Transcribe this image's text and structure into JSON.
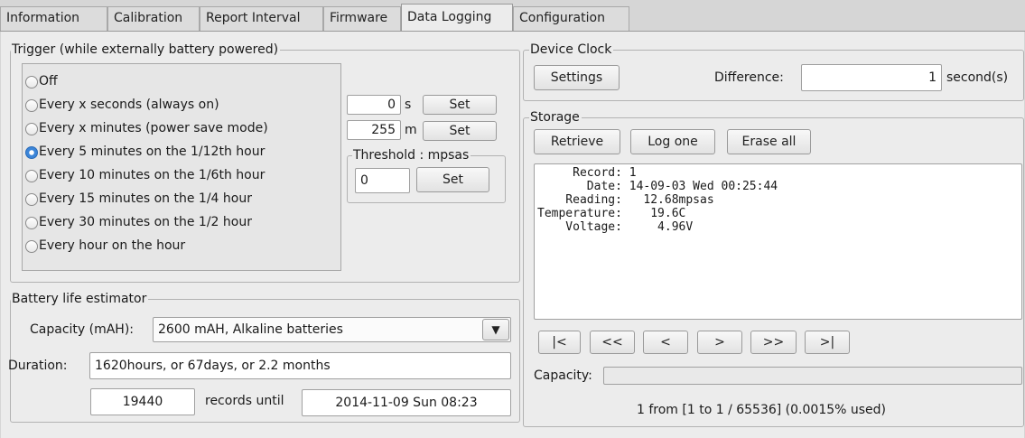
{
  "tabs": [
    "Information",
    "Calibration",
    "Report Interval",
    "Firmware",
    "Data Logging",
    "Configuration"
  ],
  "active_tab": "Data Logging",
  "trigger": {
    "title": "Trigger (while externally battery powered)",
    "options": [
      "Off",
      "Every x seconds (always on)",
      "Every x minutes (power save mode)",
      "Every 5 minutes on the 1/12th hour",
      "Every 10 minutes on the 1/6th hour",
      "Every 15 minutes on the 1/4 hour",
      "Every  30 minutes on the 1/2 hour",
      "Every hour on the hour"
    ],
    "selected_index": 3,
    "seconds_value": "0",
    "seconds_unit": "s",
    "minutes_value": "255",
    "minutes_unit": "m",
    "set_label": "Set",
    "threshold_title": "Threshold : mpsas",
    "threshold_value": "0"
  },
  "battery": {
    "title": "Battery life estimator",
    "capacity_label": "Capacity (mAH):",
    "capacity_value": "2600 mAH, Alkaline batteries",
    "duration_label": "Duration:",
    "duration_value": "1620hours, or 67days, or 2.2 months",
    "records_value": "19440",
    "records_until_label": "records until",
    "until_value": "2014-11-09 Sun 08:23"
  },
  "device_clock": {
    "title": "Device Clock",
    "settings_label": "Settings",
    "difference_label": "Difference:",
    "difference_value": "1",
    "difference_unit": "second(s)"
  },
  "storage": {
    "title": "Storage",
    "retrieve_label": "Retrieve",
    "log_one_label": "Log one",
    "erase_all_label": "Erase all",
    "record_lines": [
      "     Record: 1",
      "       Date: 14-09-03 Wed 00:25:44",
      "    Reading:   12.68mpsas",
      "Temperature:    19.6C",
      "    Voltage:     4.96V"
    ],
    "nav": [
      "|<",
      "<<",
      "<",
      ">",
      ">>",
      ">|"
    ],
    "capacity_label": "Capacity:",
    "capacity_fraction": 1.5e-05,
    "status_text": "1 from [1 to 1 / 65536] (0.0015% used)"
  },
  "colors": {
    "window_bg": "#ececec",
    "radio_selected": "#3b85d8"
  },
  "icons": {
    "dropdown": "triangle-down-icon"
  }
}
